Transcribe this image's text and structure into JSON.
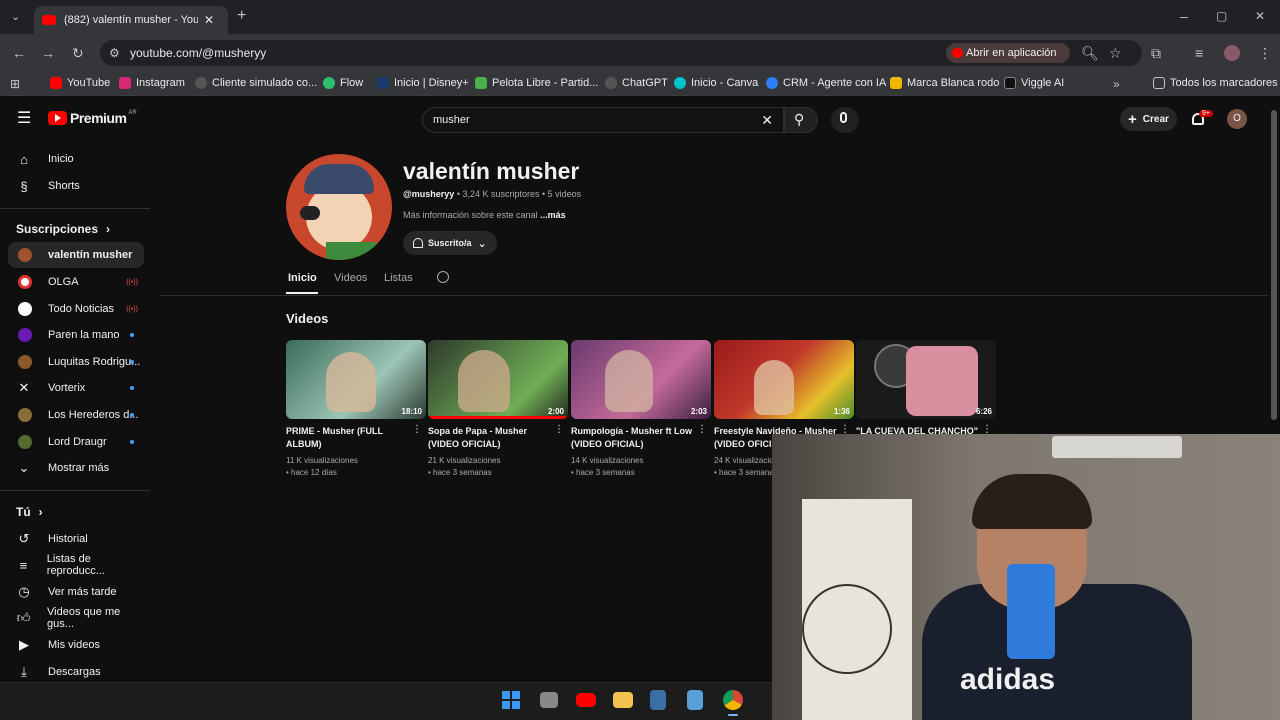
{
  "browser": {
    "tab_title": "(882) valentín musher - YouTube",
    "url": "youtube.com/@musheryy",
    "open_in_app": "Abrir en aplicación",
    "bookmarks": [
      "YouTube",
      "Instagram",
      "Cliente simulado co...",
      "Flow",
      "Inicio | Disney+",
      "Pelota Libre - Partid...",
      "ChatGPT",
      "Inicio - Canva",
      "CRM - Agente con IA",
      "Marca Blanca rodo",
      "Viggle AI"
    ],
    "all_bookmarks": "Todos los marcadores"
  },
  "youtube": {
    "logo_text": "Premium",
    "logo_sup": "AR",
    "search_value": "musher",
    "create_label": "Crear",
    "notif_badge": "9+",
    "avatar_letter": "O",
    "sidebar": {
      "top": [
        {
          "label": "Inicio",
          "icon": "home-icon"
        },
        {
          "label": "Shorts",
          "icon": "shorts-icon"
        }
      ],
      "subs_header": "Suscripciones",
      "subs": [
        {
          "label": "valentín musher",
          "color": "#a0522d",
          "status": "none"
        },
        {
          "label": "OLGA",
          "color": "#ffffff",
          "status": "live"
        },
        {
          "label": "Todo Noticias",
          "color": "#ffffff",
          "status": "live"
        },
        {
          "label": "Paren la mano",
          "color": "#6a1bb3",
          "status": "dot"
        },
        {
          "label": "Luquitas Rodrigu...",
          "color": "#8b5a2b",
          "status": "dot"
        },
        {
          "label": "Vorterix",
          "color": "#ffffff",
          "status": "dot"
        },
        {
          "label": "Los Herederos d...",
          "color": "#8a6d3b",
          "status": "dot"
        },
        {
          "label": "Lord Draugr",
          "color": "#556b2f",
          "status": "dot"
        }
      ],
      "show_more": "Mostrar más",
      "you_header": "Tú",
      "you": [
        {
          "label": "Historial",
          "icon": "history-icon"
        },
        {
          "label": "Listas de reproducc...",
          "icon": "playlists-icon"
        },
        {
          "label": "Ver más tarde",
          "icon": "watch-later-icon"
        },
        {
          "label": "Videos que me gus...",
          "icon": "liked-icon"
        },
        {
          "label": "Mis videos",
          "icon": "my-videos-icon"
        },
        {
          "label": "Descargas",
          "icon": "downloads-icon"
        }
      ]
    },
    "channel": {
      "name": "valentín musher",
      "handle": "@musheryy",
      "stats": " • 3,24 K suscriptores • 5 videos",
      "about": "Más información sobre este canal ",
      "about_more": "...más",
      "subscribed_label": "Suscrito/a",
      "tabs": [
        "Inicio",
        "Videos",
        "Listas"
      ],
      "section_title": "Videos"
    },
    "videos": [
      {
        "title": "PRIME - Musher (FULL ALBUM)",
        "duration": "18:10",
        "views": "11 K visualizaciones",
        "age": "hace 12 días",
        "colors": [
          "#3a6b5a",
          "#9cc5b5"
        ]
      },
      {
        "title": "Sopa de Papa - Musher (VIDEO OFICIAL)",
        "duration": "2:00",
        "views": "21 K visualizaciones",
        "age": "hace 3 semanas",
        "colors": [
          "#2e3a2c",
          "#6fae55"
        ]
      },
      {
        "title": "Rumpología - Musher ft Low (VIDEO OFICIAL)",
        "duration": "2:03",
        "views": "14 K visualizaciones",
        "age": "hace 3 semanas",
        "colors": [
          "#6a3a6e",
          "#c46a9a"
        ]
      },
      {
        "title": "Freestyle Navideño - Musher (VIDEO OFICIAL)",
        "duration": "1:36",
        "views": "24 K visualizaciones",
        "age": "hace 3 semanas",
        "colors": [
          "#9a1a1a",
          "#e6c02a"
        ]
      },
      {
        "title": "\"LA CUEVA DEL CHANCHO\" - ...",
        "duration": "6:26",
        "views": "",
        "age": "",
        "colors": [
          "#2a2a2a",
          "#d98fa0"
        ]
      }
    ]
  }
}
